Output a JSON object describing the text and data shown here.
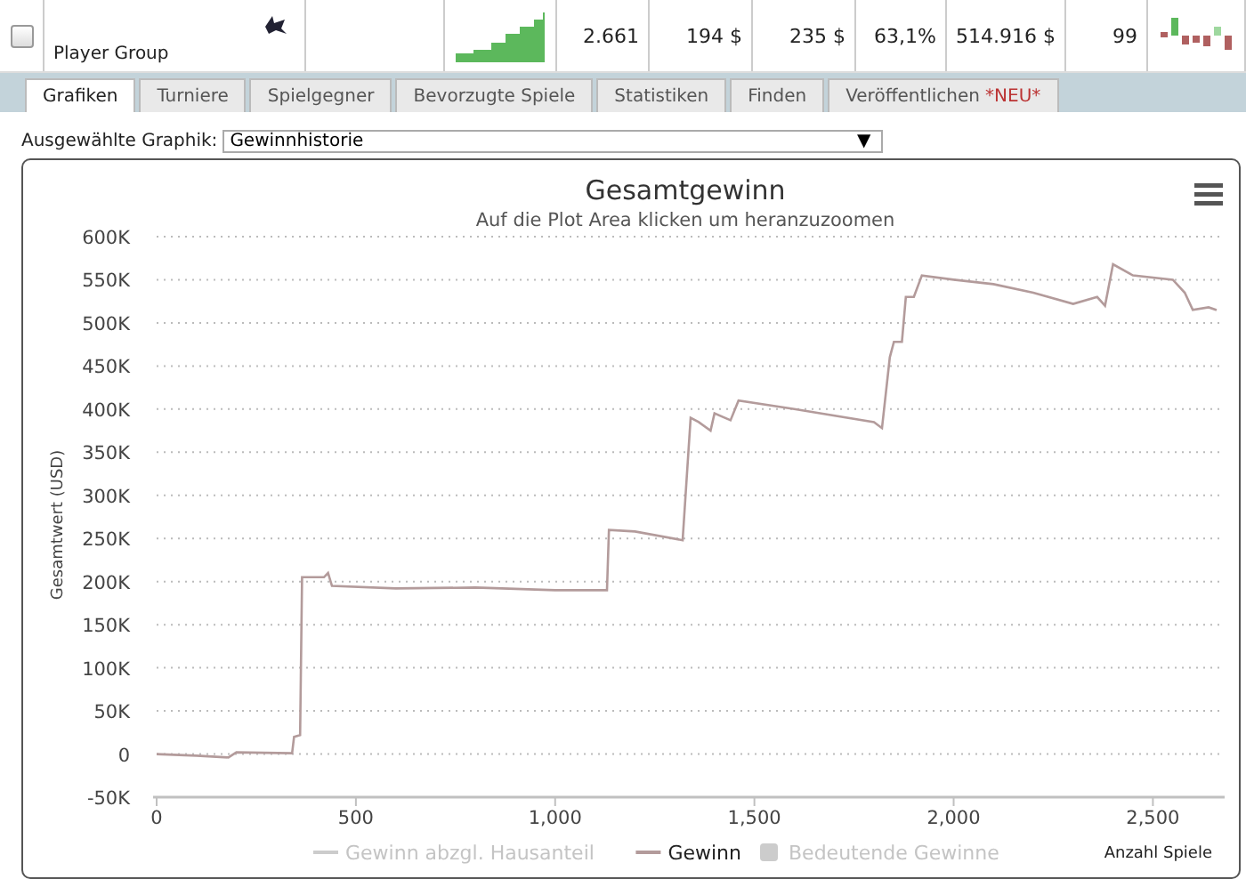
{
  "player_row": {
    "checked": false,
    "name": "Player Group",
    "cells": [
      "2.661",
      "194 $",
      "235 $",
      "63,1%",
      "514.916 $",
      "99"
    ]
  },
  "tabs": [
    {
      "label": "Grafiken",
      "selected": true
    },
    {
      "label": "Turniere",
      "selected": false
    },
    {
      "label": "Spielgegner",
      "selected": false
    },
    {
      "label": "Bevorzugte Spiele",
      "selected": false
    },
    {
      "label": "Statistiken",
      "selected": false
    },
    {
      "label": "Finden",
      "selected": false
    },
    {
      "label": "Veröffentlichen",
      "badge": "*NEU*",
      "selected": false
    }
  ],
  "graph_select": {
    "label": "Ausgewählte Graphik:",
    "value": "Gewinnhistorie",
    "caret": "▼"
  },
  "chart": {
    "chart_data": {
      "type": "line",
      "title": "Gesamtgewinn",
      "subtitle": "Auf die Plot Area klicken um heranzuzoomen",
      "xlabel": "Anzahl Spiele",
      "ylabel": "Gesamtwert (USD)",
      "xlim": [
        0,
        2680
      ],
      "grid": true,
      "ylim": [
        -50000,
        600000
      ],
      "xticks": [
        {
          "value": 0,
          "label": "0"
        },
        {
          "value": 500,
          "label": "500"
        },
        {
          "value": 1000,
          "label": "1,000"
        },
        {
          "value": 1500,
          "label": "1,500"
        },
        {
          "value": 2000,
          "label": "2,000"
        },
        {
          "value": 2500,
          "label": "2,500"
        }
      ],
      "yticks": [
        {
          "value": -50000,
          "label": "-50K"
        },
        {
          "value": 0,
          "label": "0"
        },
        {
          "value": 50000,
          "label": "50K"
        },
        {
          "value": 100000,
          "label": "100K"
        },
        {
          "value": 150000,
          "label": "150K"
        },
        {
          "value": 200000,
          "label": "200K"
        },
        {
          "value": 250000,
          "label": "250K"
        },
        {
          "value": 300000,
          "label": "300K"
        },
        {
          "value": 350000,
          "label": "350K"
        },
        {
          "value": 400000,
          "label": "400K"
        },
        {
          "value": 450000,
          "label": "450K"
        },
        {
          "value": 500000,
          "label": "500K"
        },
        {
          "value": 550000,
          "label": "550K"
        },
        {
          "value": 600000,
          "label": "600K"
        }
      ],
      "x": [
        0,
        100,
        180,
        200,
        340,
        345,
        360,
        365,
        420,
        430,
        440,
        600,
        800,
        1000,
        1130,
        1135,
        1200,
        1320,
        1340,
        1360,
        1390,
        1400,
        1440,
        1460,
        1600,
        1800,
        1820,
        1840,
        1850,
        1870,
        1880,
        1900,
        1920,
        2000,
        2100,
        2200,
        2300,
        2360,
        2380,
        2400,
        2450,
        2550,
        2580,
        2600,
        2640,
        2660
      ],
      "series": [
        {
          "name": "Gewinn",
          "color": "#b39b9b",
          "values": [
            0,
            -2000,
            -4000,
            2000,
            1000,
            20000,
            22000,
            205000,
            205000,
            210000,
            195000,
            192000,
            193000,
            190000,
            190000,
            260000,
            258000,
            248000,
            390000,
            385000,
            375000,
            395000,
            387000,
            410000,
            400000,
            385000,
            378000,
            460000,
            478000,
            478000,
            530000,
            530000,
            555000,
            550000,
            545000,
            535000,
            522000,
            530000,
            520000,
            568000,
            555000,
            550000,
            535000,
            515000,
            518000,
            515000
          ]
        }
      ]
    },
    "legend": [
      {
        "label": "Gewinn abzgl. Hausanteil",
        "kind": "line",
        "visible": false
      },
      {
        "kind": "series",
        "visible": true
      },
      {
        "label": "Bedeutende Gewinne",
        "kind": "area",
        "visible": false
      }
    ]
  }
}
